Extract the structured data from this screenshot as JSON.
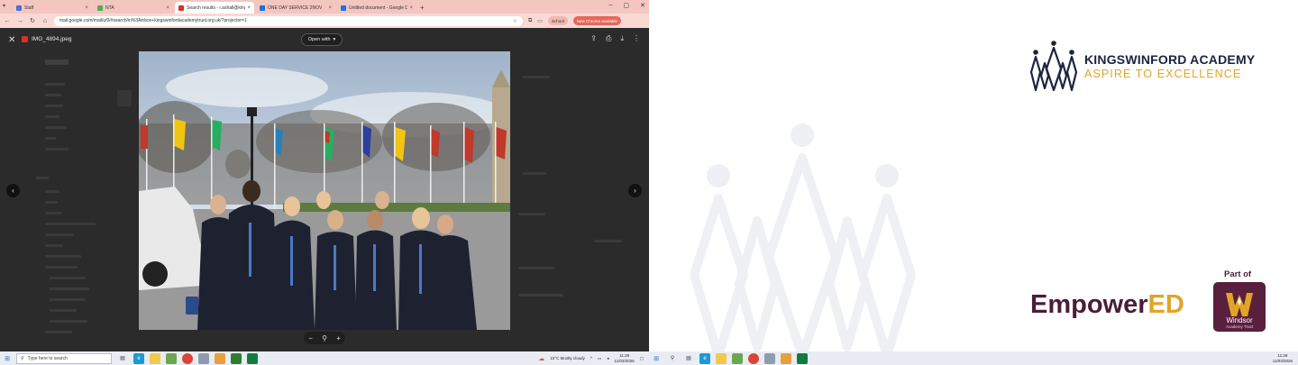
{
  "left": {
    "browser": {
      "tabs": [
        {
          "title": "Staff",
          "color": "#4a6fd8"
        },
        {
          "title": "NTA",
          "color": "#4caf50"
        },
        {
          "title": "Search results - r.ashall@kingswin…",
          "color": "#d93025",
          "active": true
        },
        {
          "title": "ONE DAY SERVICE 2NOV",
          "color": "#1a73e8"
        },
        {
          "title": "Untitled document - Google Do…",
          "color": "#1a73e8"
        }
      ],
      "url": "mail.google.com/mail/u/0/#search/in%3Ainbox+kingswinfordacademytrust.org.uk/?projector=1",
      "school_chip": "School",
      "update_chip": "New Chrome available"
    },
    "viewer": {
      "filename": "IMG_4894.jpeg",
      "open_with": "Open with"
    },
    "taskbar": {
      "search_placeholder": "Type here to search",
      "weather": "10°C  Mostly cloudy",
      "time": "11:28",
      "date": "11/03/2026"
    }
  },
  "right": {
    "brand": {
      "name": "KINGSWINFORD ACADEMY",
      "tagline": "ASPIRE TO EXCELLENCE",
      "name_color": "#1c2340",
      "accent_color": "#e0a526"
    },
    "partner": {
      "empower_a": "Empower",
      "empower_b": "ED",
      "part_of": "Part of",
      "trust_name": "Windsor",
      "trust_sub": "Academy Trust"
    },
    "taskbar": {
      "time": "11:28",
      "date": "11/03/2026"
    }
  }
}
